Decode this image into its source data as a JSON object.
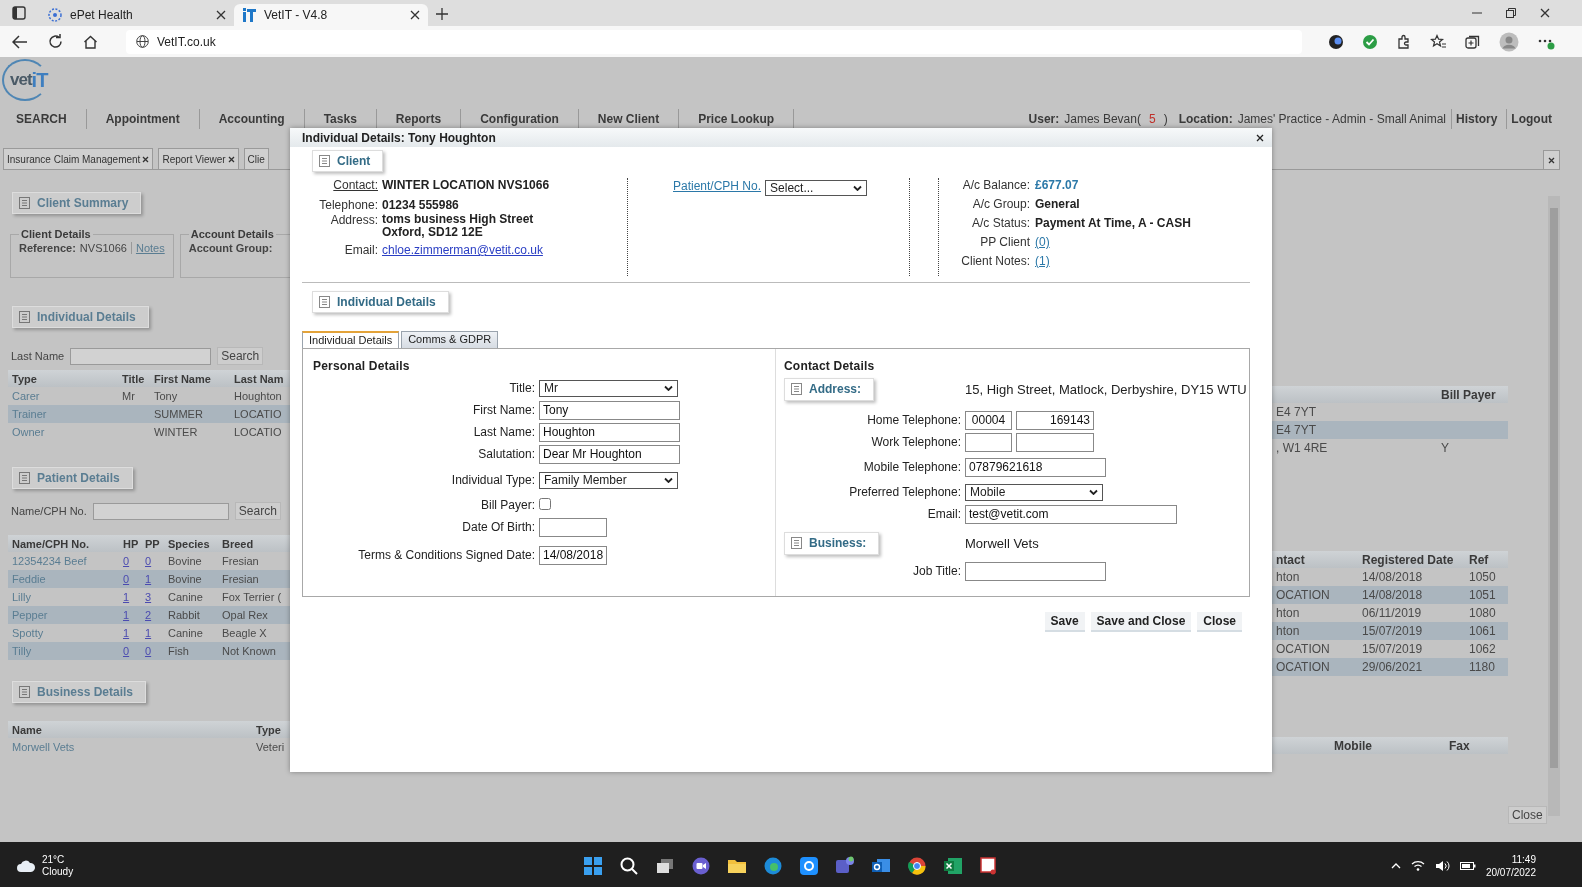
{
  "browser": {
    "tabs": [
      {
        "label": "ePet Health",
        "selected": false
      },
      {
        "label": "VetIT - V4.8",
        "selected": true
      }
    ],
    "address": "VetIT.co.uk"
  },
  "app": {
    "logo": {
      "part_1": "vet",
      "part_2": "iT"
    },
    "nav": [
      "SEARCH",
      "Appointment",
      "Accounting",
      "Tasks",
      "Reports",
      "Configuration",
      "New Client",
      "Price Lookup"
    ],
    "user_label": "User:",
    "user": "James Bevan(",
    "alert_count": "5",
    "user_suffix": ")",
    "location_label": "Location:",
    "location": "James' Practice - Admin - Small Animal",
    "links": [
      "History",
      "Logout"
    ],
    "page_tabs": [
      {
        "label": "Insurance Claim Management",
        "closable": true
      },
      {
        "label": "Report Viewer",
        "closable": true
      },
      {
        "label": "Clie",
        "closable": false
      }
    ],
    "client_summary": {
      "heading": "Client Summary",
      "client_details": {
        "legend": "Client Details",
        "reference_label": "Reference:",
        "reference": "NVS1066",
        "notes": "Notes"
      },
      "account_details": {
        "legend": "Account Details",
        "group_label": "Account Group:"
      }
    },
    "individuals": {
      "heading": "Individual Details",
      "search_label": "Last Name",
      "search_button": "Search",
      "columns": [
        "Type",
        "Title",
        "First Name",
        "Last Nam"
      ],
      "right_columns": [
        "Bill Payer"
      ],
      "rows": [
        {
          "type": "Carer",
          "title": "Mr",
          "first_name": "Tony",
          "last_name": "Houghton",
          "address": "E4 7YT"
        },
        {
          "type": "Trainer",
          "first_name": "SUMMER",
          "last_name": "LOCATIO",
          "address": "E4 7YT"
        },
        {
          "type": "Owner",
          "first_name": "WINTER",
          "last_name": "LOCATIO",
          "address": ", W1 4RE",
          "bill_payer": "Y"
        }
      ]
    },
    "patients": {
      "heading": "Patient Details",
      "search_label": "Name/CPH No.",
      "search_button": "Search",
      "columns": [
        "Name/CPH No.",
        "HP",
        "PP",
        "Species",
        "Breed"
      ],
      "right_columns": [
        "ntact",
        "Registered Date",
        "Ref"
      ],
      "rows": [
        {
          "name": "12354234 Beef",
          "hp": "0",
          "pp": "0",
          "species": "Bovine",
          "breed": "Fresian",
          "contact": "hton",
          "registered": "14/08/2018",
          "ref": "1050"
        },
        {
          "name": "Feddie",
          "hp": "0",
          "pp": "1",
          "species": "Bovine",
          "breed": "Fresian",
          "contact": "OCATION",
          "registered": "14/08/2018",
          "ref": "1051"
        },
        {
          "name": "Lilly",
          "hp": "1",
          "pp": "3",
          "species": "Canine",
          "breed": "Fox Terrier (",
          "contact": "hton",
          "registered": "06/11/2019",
          "ref": "1080"
        },
        {
          "name": "Pepper",
          "hp": "1",
          "pp": "2",
          "species": "Rabbit",
          "breed": "Opal Rex",
          "contact": "hton",
          "registered": "15/07/2019",
          "ref": "1061"
        },
        {
          "name": "Spotty",
          "hp": "1",
          "pp": "1",
          "species": "Canine",
          "breed": "Beagle X",
          "contact": "OCATION",
          "registered": "15/07/2019",
          "ref": "1062"
        },
        {
          "name": "Tilly",
          "hp": "0",
          "pp": "0",
          "species": "Fish",
          "breed": "Not Known",
          "contact": "OCATION",
          "registered": "29/06/2021",
          "ref": "1180"
        }
      ]
    },
    "businesses": {
      "heading": "Business Details",
      "columns": [
        "Name",
        "Type"
      ],
      "right_columns": [
        "Mobile",
        "Fax"
      ],
      "rows": [
        {
          "name": "Morwell Vets",
          "type": "Veteri"
        }
      ]
    },
    "close_button": "Close"
  },
  "modal": {
    "title": "Individual Details: Tony Houghton",
    "client": {
      "heading": "Client",
      "contact_label": "Contact:",
      "contact": "WINTER LOCATION NVS1066",
      "telephone_label": "Telephone:",
      "telephone": "01234 555986",
      "address_label": "Address:",
      "address_lines": [
        "toms business High Street",
        "Oxford, SD12 12E"
      ],
      "email_label": "Email:",
      "email": "chloe.zimmerman@vetit.co.uk",
      "patient_label": "Patient/CPH No.",
      "patient_select": "Select...",
      "account": [
        {
          "label": "A/c Balance:",
          "value": "£677.07",
          "kind": "money"
        },
        {
          "label": "A/c Group:",
          "value": "General",
          "kind": "text"
        },
        {
          "label": "A/c Status:",
          "value": "Payment At Time, A - CASH",
          "kind": "text"
        },
        {
          "label": "PP Client",
          "value": "(0)",
          "kind": "link"
        },
        {
          "label": "Client Notes:",
          "value": "(1)",
          "kind": "link"
        }
      ]
    },
    "section_heading": "Individual Details",
    "tabs": [
      {
        "label": "Individual Details",
        "selected": true
      },
      {
        "label": "Comms & GDPR",
        "selected": false
      }
    ],
    "personal": {
      "heading": "Personal Details",
      "fields": [
        {
          "label": "Title:",
          "kind": "select",
          "value": "Mr"
        },
        {
          "label": "First Name:",
          "kind": "text",
          "value": "Tony"
        },
        {
          "label": "Last Name:",
          "kind": "text",
          "value": "Houghton"
        },
        {
          "label": "Salutation:",
          "kind": "text",
          "value": "Dear Mr Houghton"
        },
        {
          "label": "Individual Type:",
          "kind": "select",
          "value": "Family Member"
        },
        {
          "label": "Bill Payer:",
          "kind": "checkbox",
          "checked": false
        },
        {
          "label": "Date Of Birth:",
          "kind": "date"
        },
        {
          "label": "Terms & Conditions Signed Date:",
          "kind": "date",
          "value": "14/08/2018"
        }
      ]
    },
    "contact": {
      "heading": "Contact Details",
      "address_heading": "Address:",
      "address": "15, High Street, Matlock, Derbyshire, DY15 WTU",
      "fields": [
        {
          "label": "Home Telephone:",
          "kind": "phone",
          "values": [
            "00004",
            "169143"
          ]
        },
        {
          "label": "Work Telephone:",
          "kind": "phone"
        },
        {
          "label": "Mobile Telephone:",
          "kind": "text",
          "value": "07879621618"
        },
        {
          "label": "Preferred Telephone:",
          "kind": "select",
          "value": "Mobile"
        },
        {
          "label": "Email:",
          "kind": "email",
          "value": "test@vetit.com"
        }
      ],
      "business_heading": "Business:",
      "business": "Morwell Vets",
      "business_fields": [
        {
          "label": "Job Title:",
          "kind": "text"
        }
      ]
    },
    "buttons": [
      "Save",
      "Save and Close",
      "Close"
    ]
  },
  "taskbar": {
    "temperature": "21°C",
    "weather": "Cloudy",
    "time": "11:49",
    "date": "20/07/2022"
  }
}
